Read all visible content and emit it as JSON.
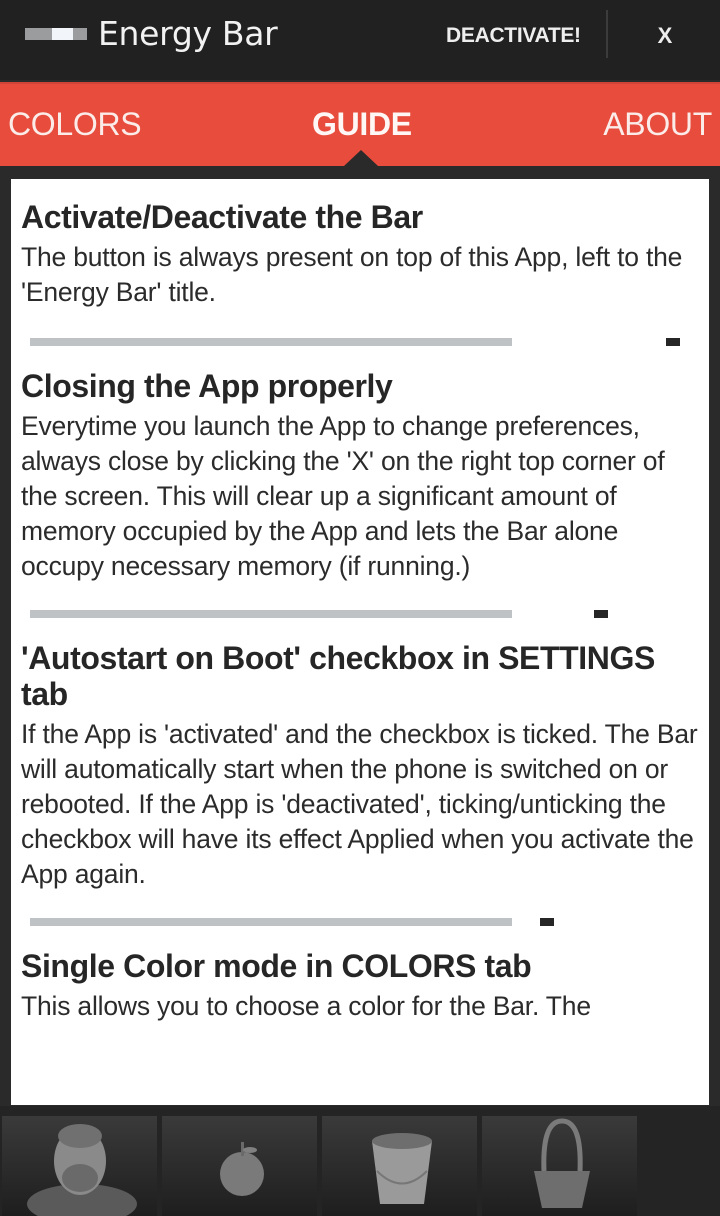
{
  "header": {
    "app_title": "Energy Bar",
    "deactivate_label": "DEACTIVATE!",
    "close_label": "X"
  },
  "tabs": [
    {
      "label": "COLORS",
      "active": false
    },
    {
      "label": "GUIDE",
      "active": true
    },
    {
      "label": "ABOUT",
      "active": false
    }
  ],
  "guide": {
    "sections": [
      {
        "title": "Activate/Deactivate the Bar",
        "body": "The button is always present on top of this App, left to the 'Energy Bar' title."
      },
      {
        "title": "Closing the App properly",
        "body": "Everytime you launch the App to change preferences, always close by clicking the 'X' on the right top corner of the screen. This will clear up a significant amount of memory occupied by the App and lets the Bar alone occupy necessary memory (if running.)"
      },
      {
        "title": "'Autostart on Boot' checkbox in SETTINGS tab",
        "body": "If the App is 'activated' and the checkbox is ticked. The Bar will automatically start when the phone is switched on or rebooted. If the App is 'deactivated', ticking/unticking the checkbox will have its effect Applied when you activate the App again."
      },
      {
        "title": "Single Color mode in COLORS tab",
        "body": "This allows you to choose a color for the Bar. The"
      }
    ]
  },
  "bottom_strip": {
    "items": [
      {
        "icon": "character-icon"
      },
      {
        "icon": "apple-icon"
      },
      {
        "icon": "bucket-icon"
      },
      {
        "icon": "basket-icon"
      }
    ]
  }
}
